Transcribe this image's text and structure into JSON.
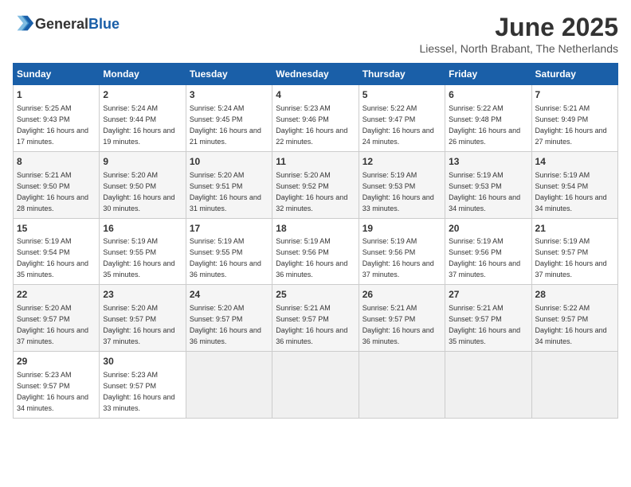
{
  "header": {
    "logo_general": "General",
    "logo_blue": "Blue",
    "month_title": "June 2025",
    "location": "Liessel, North Brabant, The Netherlands"
  },
  "weekdays": [
    "Sunday",
    "Monday",
    "Tuesday",
    "Wednesday",
    "Thursday",
    "Friday",
    "Saturday"
  ],
  "weeks": [
    [
      {
        "day": "1",
        "sunrise": "Sunrise: 5:25 AM",
        "sunset": "Sunset: 9:43 PM",
        "daylight": "Daylight: 16 hours and 17 minutes."
      },
      {
        "day": "2",
        "sunrise": "Sunrise: 5:24 AM",
        "sunset": "Sunset: 9:44 PM",
        "daylight": "Daylight: 16 hours and 19 minutes."
      },
      {
        "day": "3",
        "sunrise": "Sunrise: 5:24 AM",
        "sunset": "Sunset: 9:45 PM",
        "daylight": "Daylight: 16 hours and 21 minutes."
      },
      {
        "day": "4",
        "sunrise": "Sunrise: 5:23 AM",
        "sunset": "Sunset: 9:46 PM",
        "daylight": "Daylight: 16 hours and 22 minutes."
      },
      {
        "day": "5",
        "sunrise": "Sunrise: 5:22 AM",
        "sunset": "Sunset: 9:47 PM",
        "daylight": "Daylight: 16 hours and 24 minutes."
      },
      {
        "day": "6",
        "sunrise": "Sunrise: 5:22 AM",
        "sunset": "Sunset: 9:48 PM",
        "daylight": "Daylight: 16 hours and 26 minutes."
      },
      {
        "day": "7",
        "sunrise": "Sunrise: 5:21 AM",
        "sunset": "Sunset: 9:49 PM",
        "daylight": "Daylight: 16 hours and 27 minutes."
      }
    ],
    [
      {
        "day": "8",
        "sunrise": "Sunrise: 5:21 AM",
        "sunset": "Sunset: 9:50 PM",
        "daylight": "Daylight: 16 hours and 28 minutes."
      },
      {
        "day": "9",
        "sunrise": "Sunrise: 5:20 AM",
        "sunset": "Sunset: 9:50 PM",
        "daylight": "Daylight: 16 hours and 30 minutes."
      },
      {
        "day": "10",
        "sunrise": "Sunrise: 5:20 AM",
        "sunset": "Sunset: 9:51 PM",
        "daylight": "Daylight: 16 hours and 31 minutes."
      },
      {
        "day": "11",
        "sunrise": "Sunrise: 5:20 AM",
        "sunset": "Sunset: 9:52 PM",
        "daylight": "Daylight: 16 hours and 32 minutes."
      },
      {
        "day": "12",
        "sunrise": "Sunrise: 5:19 AM",
        "sunset": "Sunset: 9:53 PM",
        "daylight": "Daylight: 16 hours and 33 minutes."
      },
      {
        "day": "13",
        "sunrise": "Sunrise: 5:19 AM",
        "sunset": "Sunset: 9:53 PM",
        "daylight": "Daylight: 16 hours and 34 minutes."
      },
      {
        "day": "14",
        "sunrise": "Sunrise: 5:19 AM",
        "sunset": "Sunset: 9:54 PM",
        "daylight": "Daylight: 16 hours and 34 minutes."
      }
    ],
    [
      {
        "day": "15",
        "sunrise": "Sunrise: 5:19 AM",
        "sunset": "Sunset: 9:54 PM",
        "daylight": "Daylight: 16 hours and 35 minutes."
      },
      {
        "day": "16",
        "sunrise": "Sunrise: 5:19 AM",
        "sunset": "Sunset: 9:55 PM",
        "daylight": "Daylight: 16 hours and 35 minutes."
      },
      {
        "day": "17",
        "sunrise": "Sunrise: 5:19 AM",
        "sunset": "Sunset: 9:55 PM",
        "daylight": "Daylight: 16 hours and 36 minutes."
      },
      {
        "day": "18",
        "sunrise": "Sunrise: 5:19 AM",
        "sunset": "Sunset: 9:56 PM",
        "daylight": "Daylight: 16 hours and 36 minutes."
      },
      {
        "day": "19",
        "sunrise": "Sunrise: 5:19 AM",
        "sunset": "Sunset: 9:56 PM",
        "daylight": "Daylight: 16 hours and 37 minutes."
      },
      {
        "day": "20",
        "sunrise": "Sunrise: 5:19 AM",
        "sunset": "Sunset: 9:56 PM",
        "daylight": "Daylight: 16 hours and 37 minutes."
      },
      {
        "day": "21",
        "sunrise": "Sunrise: 5:19 AM",
        "sunset": "Sunset: 9:57 PM",
        "daylight": "Daylight: 16 hours and 37 minutes."
      }
    ],
    [
      {
        "day": "22",
        "sunrise": "Sunrise: 5:20 AM",
        "sunset": "Sunset: 9:57 PM",
        "daylight": "Daylight: 16 hours and 37 minutes."
      },
      {
        "day": "23",
        "sunrise": "Sunrise: 5:20 AM",
        "sunset": "Sunset: 9:57 PM",
        "daylight": "Daylight: 16 hours and 37 minutes."
      },
      {
        "day": "24",
        "sunrise": "Sunrise: 5:20 AM",
        "sunset": "Sunset: 9:57 PM",
        "daylight": "Daylight: 16 hours and 36 minutes."
      },
      {
        "day": "25",
        "sunrise": "Sunrise: 5:21 AM",
        "sunset": "Sunset: 9:57 PM",
        "daylight": "Daylight: 16 hours and 36 minutes."
      },
      {
        "day": "26",
        "sunrise": "Sunrise: 5:21 AM",
        "sunset": "Sunset: 9:57 PM",
        "daylight": "Daylight: 16 hours and 36 minutes."
      },
      {
        "day": "27",
        "sunrise": "Sunrise: 5:21 AM",
        "sunset": "Sunset: 9:57 PM",
        "daylight": "Daylight: 16 hours and 35 minutes."
      },
      {
        "day": "28",
        "sunrise": "Sunrise: 5:22 AM",
        "sunset": "Sunset: 9:57 PM",
        "daylight": "Daylight: 16 hours and 34 minutes."
      }
    ],
    [
      {
        "day": "29",
        "sunrise": "Sunrise: 5:23 AM",
        "sunset": "Sunset: 9:57 PM",
        "daylight": "Daylight: 16 hours and 34 minutes."
      },
      {
        "day": "30",
        "sunrise": "Sunrise: 5:23 AM",
        "sunset": "Sunset: 9:57 PM",
        "daylight": "Daylight: 16 hours and 33 minutes."
      },
      null,
      null,
      null,
      null,
      null
    ]
  ]
}
